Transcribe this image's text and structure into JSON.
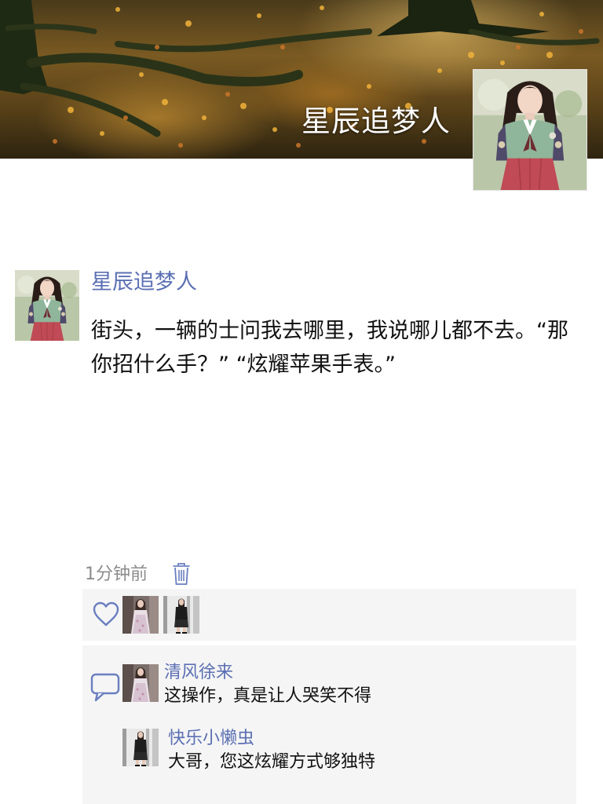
{
  "cover": {
    "title": "星辰追梦人",
    "avatar_icon": "user-avatar-woman-hanbok"
  },
  "post": {
    "username": "星辰追梦人",
    "text": "街头，一辆的士问我去哪里，我说哪儿都不去。“那你招什么手？” “炫耀苹果手表。”",
    "time": "1分钟前",
    "delete_icon": "trash-icon"
  },
  "likes": {
    "icon": "heart-icon",
    "avatars": [
      "liker-avatar-1",
      "liker-avatar-2"
    ]
  },
  "comments": {
    "icon": "comment-bubble-icon",
    "items": [
      {
        "user": "清风徐来",
        "text": "这操作，真是让人哭笑不得"
      },
      {
        "user": "快乐小懒虫",
        "text": "大哥，您这炫耀方式够独特"
      }
    ]
  },
  "colors": {
    "name_blue": "#5b6fb3",
    "meta_gray": "#8c8c8c",
    "panel_bg": "#f5f5f5",
    "icon_blue": "#6a7fc0"
  }
}
